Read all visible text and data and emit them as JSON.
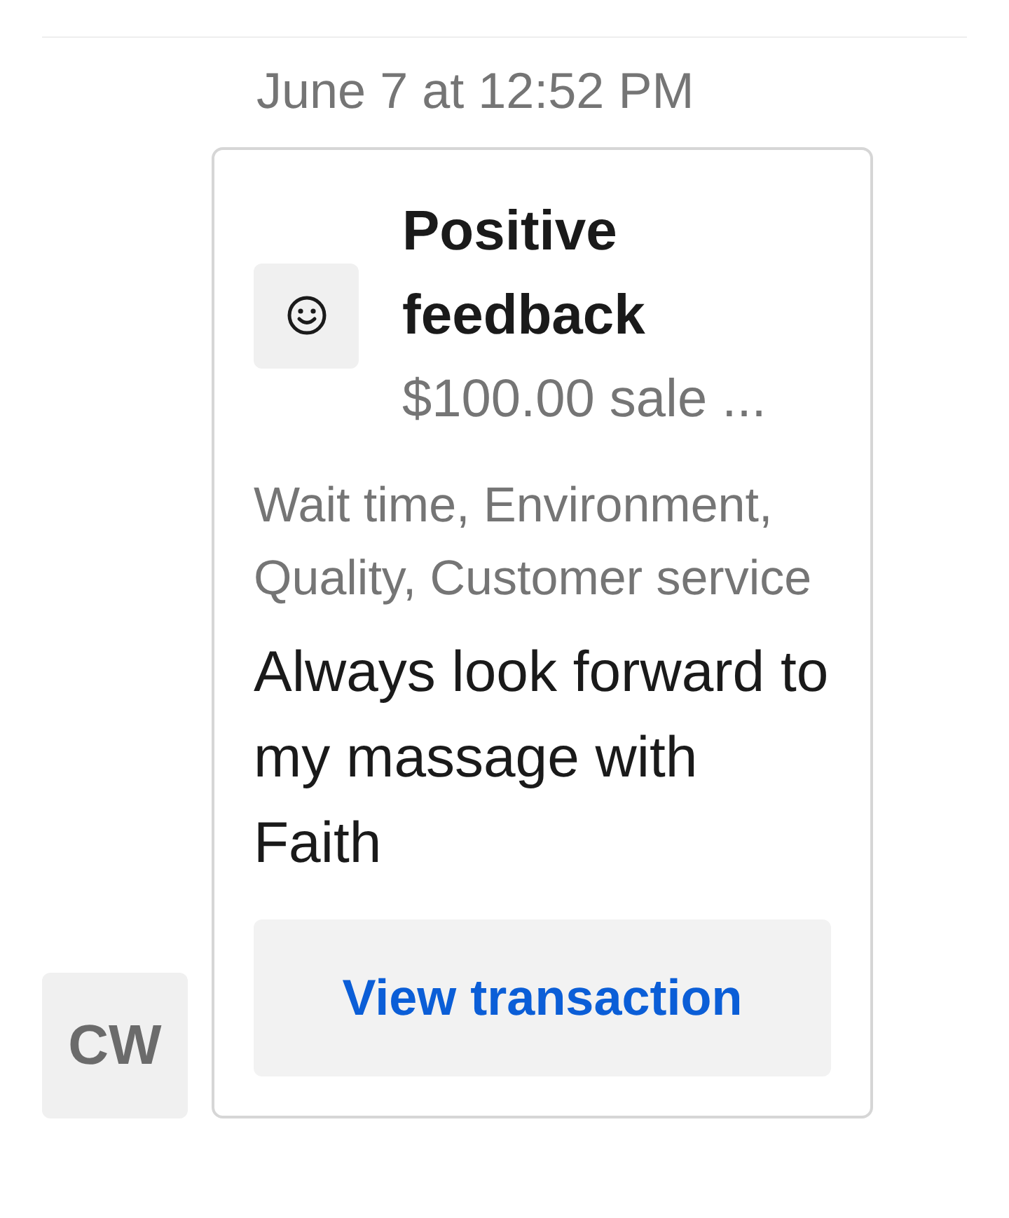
{
  "timestamp": "June 7 at 12:52 PM",
  "avatar": {
    "initials": "CW"
  },
  "card": {
    "title": "Positive feedback",
    "subtitle": "$100.00 sale ...",
    "tags": "Wait time, Environment, Quality, Customer service",
    "message": "Always look forward to my massage with Faith",
    "button": "View transaction"
  }
}
